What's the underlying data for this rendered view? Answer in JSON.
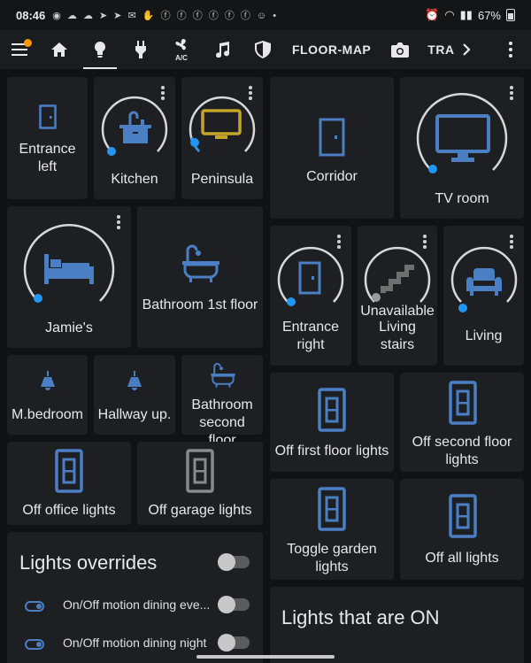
{
  "status_bar": {
    "time": "08:46",
    "battery": "67%",
    "notification_icons": [
      "whatsapp",
      "cloud",
      "cloud",
      "telegram",
      "telegram",
      "mail",
      "hand",
      "facebook",
      "facebook",
      "facebook",
      "facebook",
      "facebook",
      "facebook",
      "snapchat",
      "dot"
    ]
  },
  "app_bar": {
    "tabs": [
      {
        "icon": "home-icon"
      },
      {
        "icon": "lightbulb-icon",
        "active": true
      },
      {
        "icon": "plug-icon"
      },
      {
        "icon": "ac-fan-icon",
        "sub": "A/C"
      },
      {
        "icon": "music-icon"
      },
      {
        "icon": "shield-icon"
      },
      {
        "label": "FLOOR-MAP"
      },
      {
        "icon": "camera-icon"
      },
      {
        "label": "TRA"
      }
    ]
  },
  "accent": "#2196f3",
  "icon_color": "#4b7fc3",
  "tv_color": "#c4a429",
  "cards": {
    "entrance_left": "Entrance left",
    "kitchen": "Kitchen",
    "peninsula": "Peninsula",
    "corridor": "Corridor",
    "tv_room": "TV room",
    "jamies": "Jamie's",
    "bathroom_1st": "Bathroom 1st floor",
    "entrance_right": "Entrance right",
    "stairs_state": "Unavailable",
    "stairs": "Living stairs",
    "living": "Living",
    "m_bedroom": "M.bedroom",
    "hallway_up": "Hallway up.",
    "bathroom_2nd": "Bathroom second floor",
    "off_first_floor": "Off first floor lights",
    "off_second_floor": "Off second floor lights",
    "off_office": "Off office lights",
    "off_garage": "Off garage lights",
    "toggle_garden": "Toggle garden lights",
    "off_all": "Off all lights"
  },
  "overrides": {
    "title": "Lights overrides",
    "rows": [
      {
        "label": "On/Off motion dining eve..."
      },
      {
        "label": "On/Off motion dining night"
      }
    ]
  },
  "lights_on": {
    "title": "Lights that are ON"
  }
}
